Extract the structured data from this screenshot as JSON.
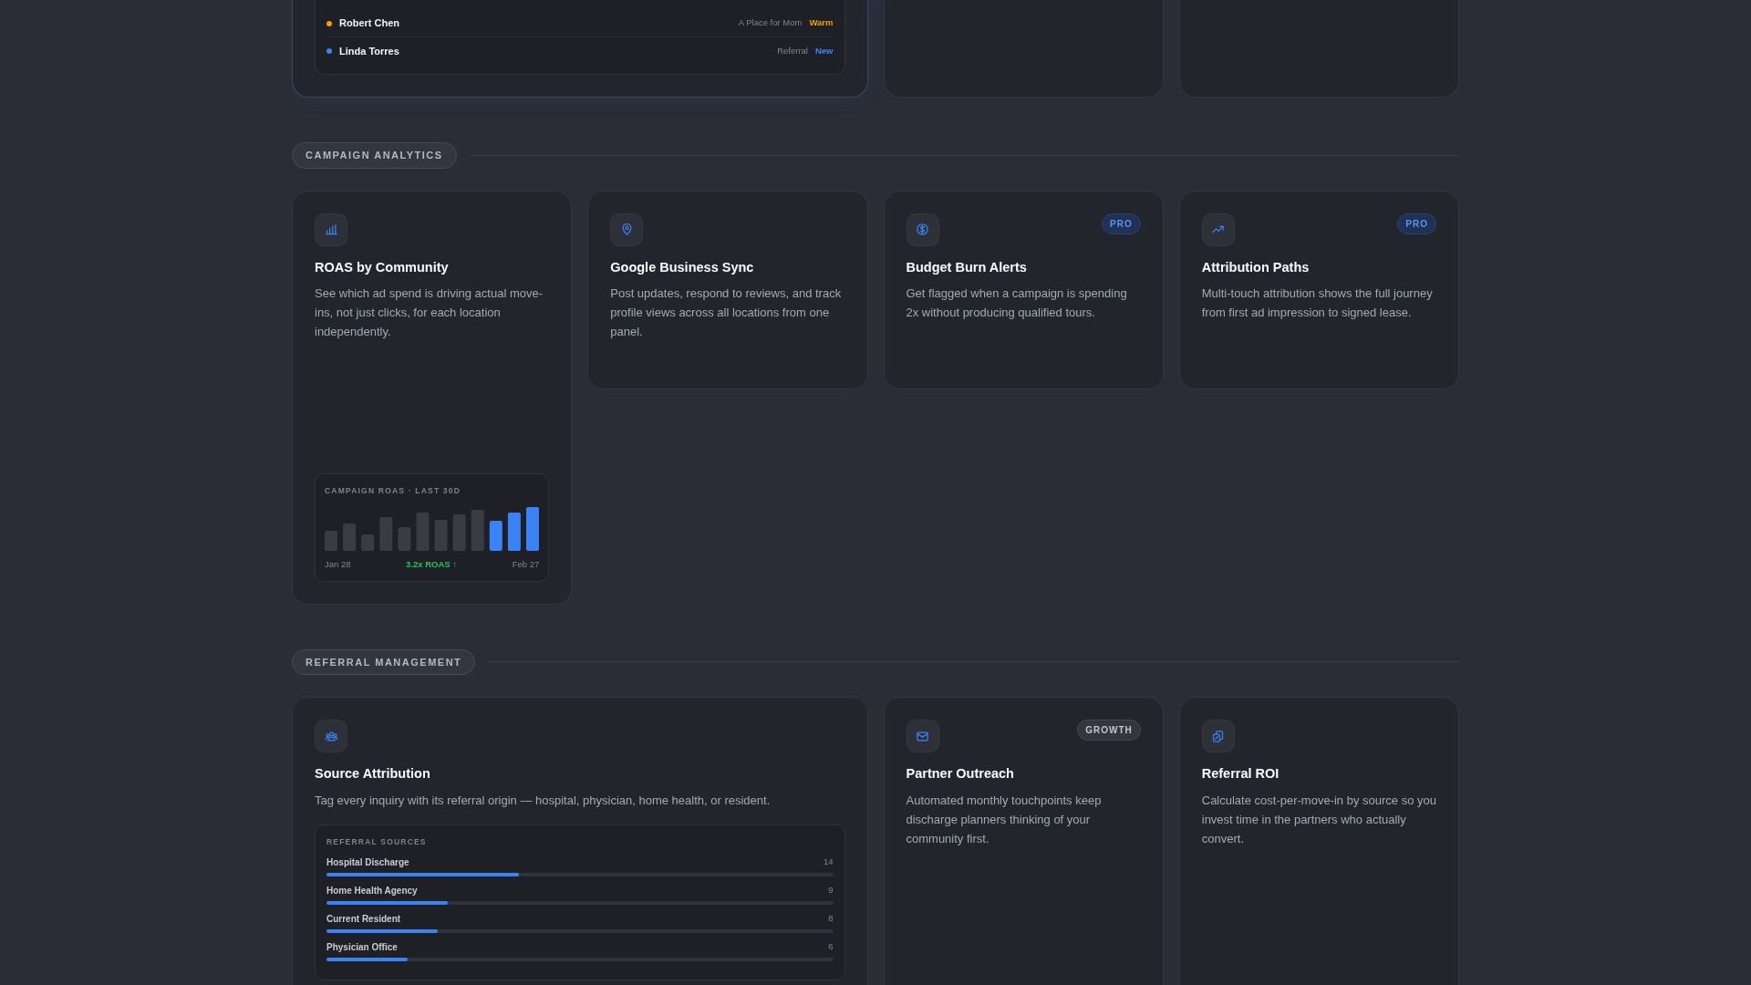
{
  "leads_card": {
    "leads": [
      {
        "name": "Robert Chen",
        "source": "A Place for Mom",
        "status": "Warm",
        "color": "#f59e0b"
      },
      {
        "name": "Linda Torres",
        "source": "Referral",
        "status": "New",
        "color": "#3b82f6"
      }
    ]
  },
  "sections": [
    {
      "title": "CAMPAIGN ANALYTICS",
      "cards": [
        {
          "title": "ROAS by Community",
          "description": "See which ad spend is driving actual move-ins, not just clicks, for each location independently.",
          "chart_panel": {
            "title": "CAMPAIGN ROAS · LAST 30D",
            "start": "Jan 28",
            "summary": "3.2x ROAS ↑",
            "end": "Feb 27"
          }
        },
        {
          "title": "Google Business Sync",
          "description": "Post updates, respond to reviews, and track profile views across all locations from one panel."
        },
        {
          "title": "Budget Burn Alerts",
          "description": "Get flagged when a campaign is spending 2x without producing qualified tours.",
          "badge": {
            "text": "PRO",
            "kind": "pro"
          }
        },
        {
          "title": "Attribution Paths",
          "description": "Multi-touch attribution shows the full journey from first ad impression to signed lease.",
          "badge": {
            "text": "PRO",
            "kind": "pro"
          }
        }
      ]
    },
    {
      "title": "REFERRAL MANAGEMENT",
      "cards": [
        {
          "title": "Source Attribution",
          "description": "Tag every inquiry with its referral origin — hospital, physician, home health, or resident.",
          "wide": true,
          "sources_panel": {
            "title": "REFERRAL SOURCES",
            "sources": [
              {
                "name": "Hospital Discharge",
                "count": "14",
                "level": 0.38
              },
              {
                "name": "Home Health Agency",
                "count": "9",
                "level": 0.24
              },
              {
                "name": "Current Resident",
                "count": "8",
                "level": 0.22
              },
              {
                "name": "Physician Office",
                "count": "6",
                "level": 0.16
              }
            ]
          }
        },
        {
          "title": "Partner Outreach",
          "description": "Automated monthly touchpoints keep discharge planners thinking of your community first.",
          "badge": {
            "text": "GROWTH",
            "kind": "growth"
          }
        },
        {
          "title": "Referral ROI",
          "description": "Calculate cost-per-move-in by source so you invest time in the partners who actually convert."
        }
      ]
    }
  ]
}
